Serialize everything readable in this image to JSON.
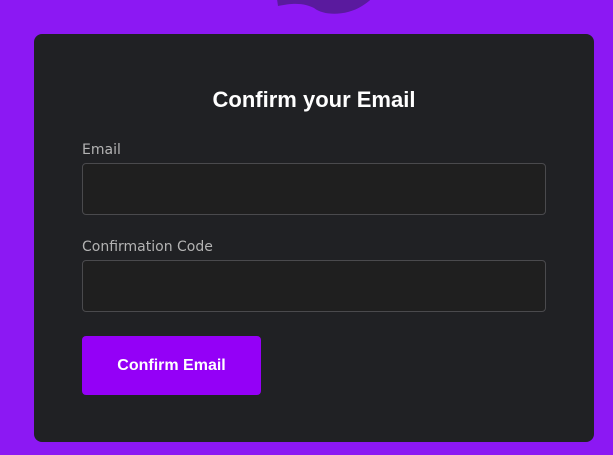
{
  "colors": {
    "page_background": "#8c18f3",
    "card_background": "#202124",
    "input_background": "#1f1f1f",
    "input_border": "#4a4a4d",
    "button_background": "#9400f7",
    "logo": "#5a1a9e"
  },
  "logo": {
    "icon": "brand-logo-icon"
  },
  "form": {
    "title": "Confirm your Email",
    "email": {
      "label": "Email",
      "value": "",
      "placeholder": ""
    },
    "code": {
      "label": "Confirmation Code",
      "value": "",
      "placeholder": ""
    },
    "submit_label": "Confirm Email"
  }
}
